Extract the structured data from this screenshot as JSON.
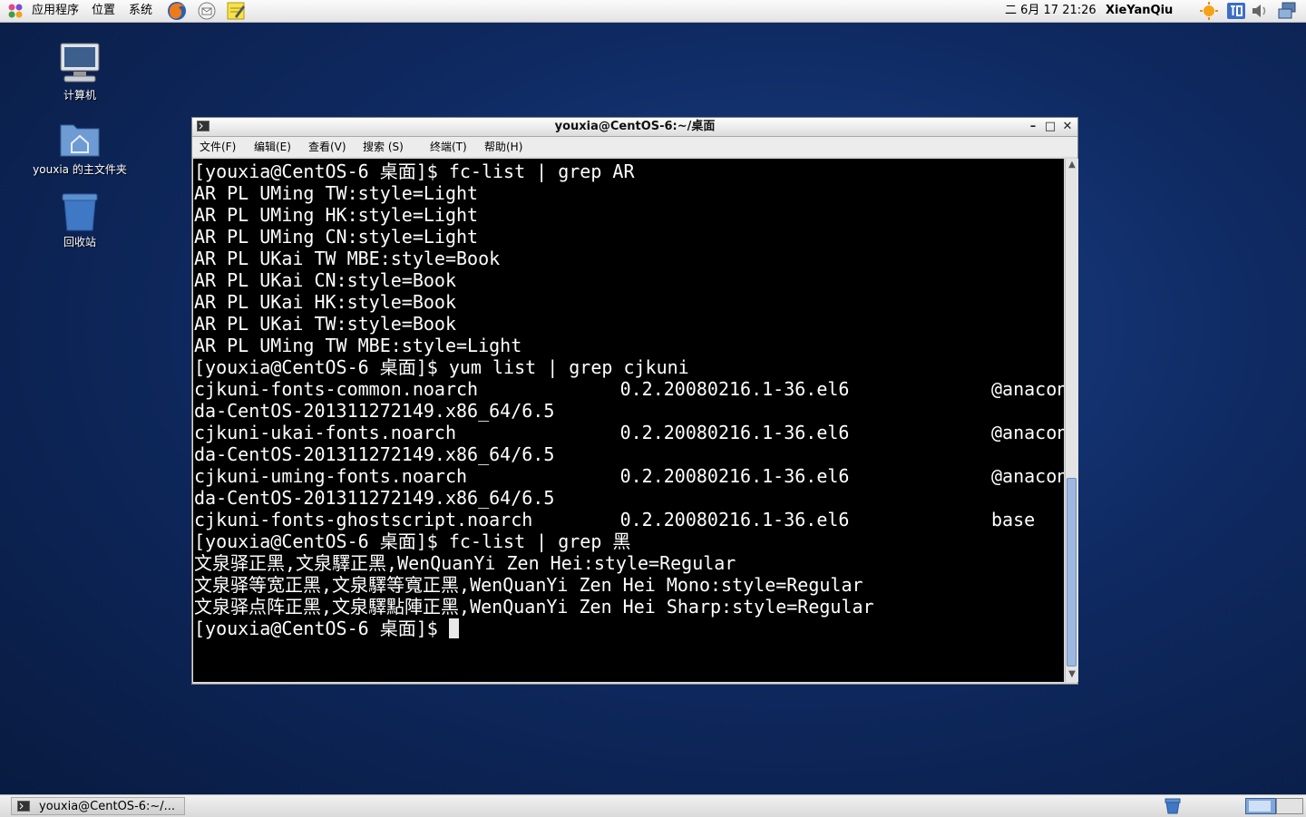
{
  "top_panel": {
    "menus": [
      "应用程序",
      "位置",
      "系统"
    ],
    "clock": "二 6月 17 21:26",
    "user": "XieYanQiu",
    "launchers": [
      "firefox-icon",
      "mail-icon",
      "notes-icon"
    ],
    "tray": [
      "weather-icon",
      "input-method-icon",
      "volume-icon",
      "network-icon"
    ]
  },
  "desktop": {
    "icons": [
      {
        "label": "计算机",
        "icon": "computer-icon"
      },
      {
        "label": "youxia 的主文件夹",
        "icon": "home-folder-icon"
      },
      {
        "label": "回收站",
        "icon": "trash-icon"
      }
    ]
  },
  "terminal": {
    "title": "youxia@CentOS-6:~/桌面",
    "menu": [
      "文件(F)",
      "编辑(E)",
      "查看(V)",
      "搜索 (S)",
      "终端(T)",
      "帮助(H)"
    ],
    "lines": [
      "[youxia@CentOS-6 桌面]$ fc-list | grep AR",
      "AR PL UMing TW:style=Light",
      "AR PL UMing HK:style=Light",
      "AR PL UMing CN:style=Light",
      "AR PL UKai TW MBE:style=Book",
      "AR PL UKai CN:style=Book",
      "AR PL UKai HK:style=Book",
      "AR PL UKai TW:style=Book",
      "AR PL UMing TW MBE:style=Light",
      "[youxia@CentOS-6 桌面]$ yum list | grep cjkuni",
      "cjkuni-fonts-common.noarch             0.2.20080216.1-36.el6             @anacon",
      "da-CentOS-201311272149.x86_64/6.5",
      "cjkuni-ukai-fonts.noarch               0.2.20080216.1-36.el6             @anacon",
      "da-CentOS-201311272149.x86_64/6.5",
      "cjkuni-uming-fonts.noarch              0.2.20080216.1-36.el6             @anacon",
      "da-CentOS-201311272149.x86_64/6.5",
      "cjkuni-fonts-ghostscript.noarch        0.2.20080216.1-36.el6             base",
      "[youxia@CentOS-6 桌面]$ fc-list | grep 黑",
      "文泉驿正黑,文泉驛正黑,WenQuanYi Zen Hei:style=Regular",
      "文泉驿等宽正黑,文泉驛等寬正黑,WenQuanYi Zen Hei Mono:style=Regular",
      "文泉驿点阵正黑,文泉驛點陣正黑,WenQuanYi Zen Hei Sharp:style=Regular"
    ],
    "prompt": "[youxia@CentOS-6 桌面]$ "
  },
  "taskbar": {
    "task_label": "youxia@CentOS-6:~/..."
  }
}
